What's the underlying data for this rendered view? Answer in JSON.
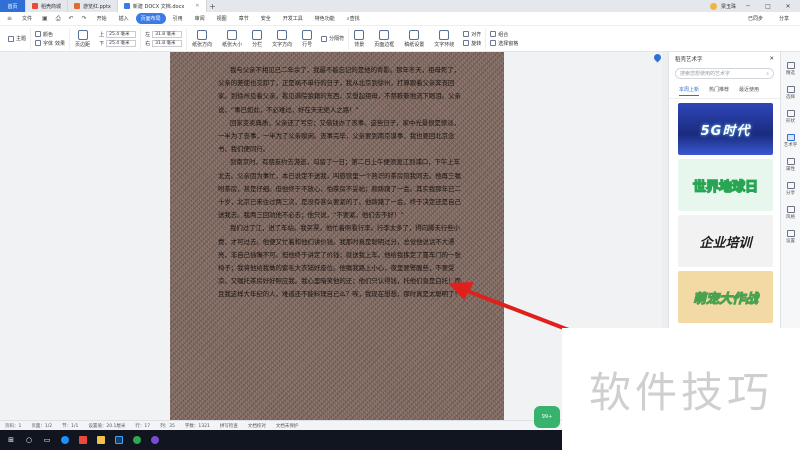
{
  "titlebar": {
    "home": "首页",
    "tabs": [
      {
        "label": "稻壳商城",
        "color": "#e84a3c"
      },
      {
        "label": "游览红.pptx",
        "color": "#e06b2c"
      },
      {
        "label": "新建 DOCX 文档.docx",
        "color": "#3b7be8"
      }
    ],
    "add": "+",
    "user_name": "梁玉珠",
    "minimize": "─",
    "maximize": "□",
    "close": "✕"
  },
  "menubar": {
    "file": "文件",
    "items": [
      "开始",
      "插入",
      "页面布局",
      "引用",
      "审阅",
      "视图",
      "章节",
      "安全",
      "开发工具",
      "特色功能"
    ],
    "active_index": 2,
    "search": "查找",
    "right": [
      "已同步",
      "分享"
    ]
  },
  "ribbon": {
    "theme": "主题",
    "colors": "颜色",
    "fonts": "字体",
    "effects": "效果",
    "page_margin": "页边距",
    "top_label": "上",
    "top_value": "25.4 毫米",
    "bottom_label": "下",
    "bottom_value": "25.4 毫米",
    "left_label": "左",
    "left_value": "31.8 毫米",
    "right_label": "右",
    "right_value": "31.8 毫米",
    "orientation": "纸张方向",
    "size": "纸张大小",
    "columns": "分栏",
    "text_direction": "文字方向",
    "line_numbers": "行号",
    "breaks": "分隔符",
    "background": "背景",
    "borders": "页面边框",
    "draft_paper": "稿纸设置",
    "wrap": "文字环绕",
    "align": "对齐",
    "rotate": "旋转",
    "group": "组合",
    "select_pane": "选择窗格"
  },
  "document": {
    "paragraphs": [
      "我与父亲不相见已二年余了，我最不能忘记的是他的背影。那年冬天，祖母死了，父亲的差使也交卸了，正是祸不单行的日子，我从北京到徐州，打算跟着父亲奔丧回家。到徐州见着父亲，看见满院狼藉的东西，又想起祖母，不禁簌簌地流下眼泪。父亲说，“事已如此，不必难过，好在天无绝人之路！”",
      "回家变卖典质，父亲还了亏空；又借钱办了丧事。这些日子，家中光景很是惨淡，一半为了丧事，一半为了父亲赋闲。丧事完毕，父亲要到南京谋事，我也要回北京念书，我们便同行。",
      "到南京时，有朋友约去游逛，勾留了一日；第二日上午便须渡江到浦口，下午上车北去。父亲因为事忙，本已说定不送我，叫旅馆里一个熟识的茶房陪我同去。他再三嘱咐茶房，甚是仔细。但他终于不放心，怕茶房不妥帖；颇踌躇了一会。其实我那年已二十岁，北京已来往过两三次，是没有甚么要紧的了。他踌躇了一会，终于决定还是自己送我去。我两三回劝他不必去；他只说，“不要紧，他们去不好！”",
      "我们过了江，进了车站。我买票，他忙着照看行李。行李太多了，得向脚夫行些小费，才可过去。他便又忙着和他们讲价钱。我那时真是聪明过分，总觉他说话不大漂亮，非自己插嘴不可。但他终于讲定了价钱；就送我上车。他给我拣定了靠车门的一张椅子；我将他给我做的紫毛大衣铺好座位。他嘱我路上小心，夜里要警醒些，不要受凉。又嘱托茶房好好照应我。我心里暗笑他的迂；他们只认得钱，托他们直是白托！而且我这样大年纪的人，难道还不能料理自己么？唉，我现在想想，那时真是太聪明了！"
    ]
  },
  "side_panel": {
    "title": "稻壳艺术字",
    "close": "✕",
    "search_placeholder": "搜索您想使用的艺术字",
    "tabs": [
      "本周上新",
      "热门推荐",
      "最近使用"
    ],
    "cards": [
      "5G时代",
      "世界地球日",
      "企业培训",
      "萌宠大作战"
    ]
  },
  "right_toolbar": [
    "精选",
    "选择",
    "形状",
    "艺术字",
    "属性",
    "分享",
    "风格",
    "设置"
  ],
  "statusbar": {
    "items": [
      "页码：1",
      "页面：1/2",
      "节：1/1",
      "设置值：20.1厘米",
      "行：17",
      "列：35",
      "字数：1321",
      "拼写检查",
      "文档校对",
      "文档未保护"
    ]
  },
  "overlays": {
    "badge": "99+",
    "watermark": "软件技巧"
  },
  "colors": {
    "accent": "#3b7be8",
    "arrow": "#e0201b",
    "taskbar": "#10151f"
  }
}
